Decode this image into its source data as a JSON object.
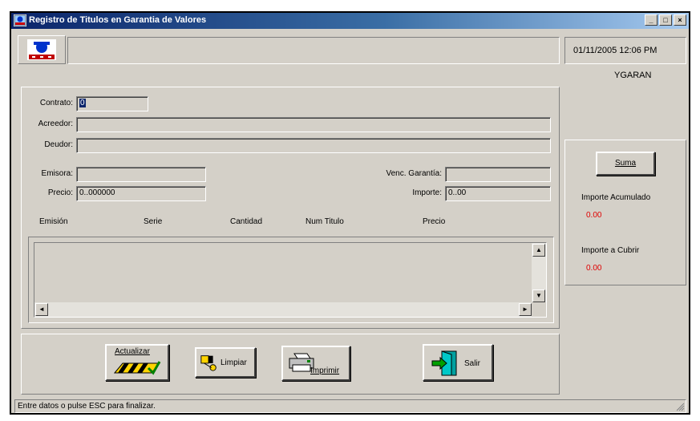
{
  "window": {
    "title": "Registro de Titulos en Garantia de Valores",
    "min_label": "_",
    "max_label": "□",
    "close_label": "×"
  },
  "header": {
    "datetime": "01/11/2005 12:06 PM",
    "user": "YGARAN"
  },
  "form": {
    "contrato_label": "Contrato:",
    "contrato_value": "0",
    "acreedor_label": "Acreedor:",
    "deudor_label": "Deudor:",
    "emisora_label": "Emisora:",
    "venc_label": "Venc. Garantía:",
    "precio_label": "Precio:",
    "precio_value": "0..000000",
    "importe_label": "Importe:",
    "importe_value": "0..00"
  },
  "table": {
    "columns": [
      "Emisión",
      "Serie",
      "Cantidad",
      "Num Titulo",
      "Precio"
    ]
  },
  "side": {
    "suma_label": "Suma",
    "importe_acumulado_label": "Importe Acumulado",
    "importe_acumulado_value": "0.00",
    "importe_cubrir_label": "Importe a Cubrir",
    "importe_cubrir_value": "0.00"
  },
  "toolbar": {
    "actualizar_label": "Actualizar",
    "limpiar_label": "Limpiar",
    "imprimir_label": "Imprimir",
    "salir_label": "Salir"
  },
  "status": {
    "text": "Entre datos o pulse ESC para finalizar."
  },
  "colors": {
    "titlebar": "#0a246a",
    "face": "#d4d0c8",
    "value_red": "#e00000"
  }
}
